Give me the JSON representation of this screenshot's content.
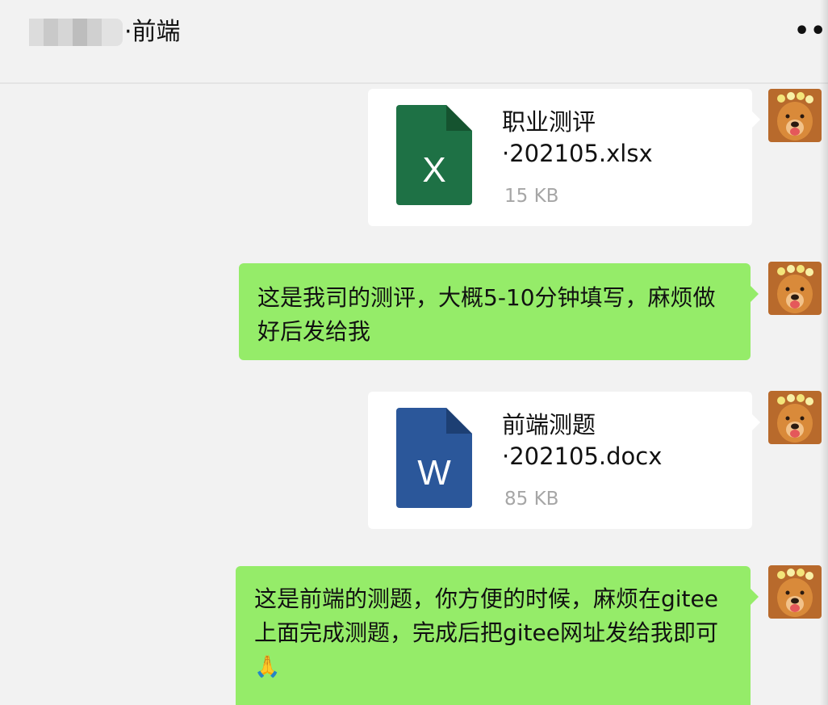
{
  "header": {
    "title": "·前端",
    "more_label": "•••"
  },
  "messages": [
    {
      "type": "file",
      "file_type": "xlsx",
      "icon_letter": "X",
      "icon_color": "#1e7145",
      "name_line1": "职业测评",
      "name_line2": "·202105.xlsx",
      "size": "15 KB"
    },
    {
      "type": "text",
      "lines": [
        "这是我司的测评，大概5-10分钟填写，麻烦做",
        "好后发给我"
      ]
    },
    {
      "type": "file",
      "file_type": "docx",
      "icon_letter": "W",
      "icon_color": "#2b579a",
      "name_line1": "前端测题",
      "name_line2": "·202105.docx",
      "size": "85 KB"
    },
    {
      "type": "text",
      "lines": [
        "这是前端的测题，你方便的时候，麻烦在gitee",
        "上面完成测题，完成后把gitee网址发给我即可",
        "🙏"
      ]
    }
  ],
  "colors": {
    "chat_bg": "#f2f2f2",
    "bubble_green": "#95ec69",
    "file_card_bg": "#ffffff",
    "size_text": "#a6a6a6"
  }
}
